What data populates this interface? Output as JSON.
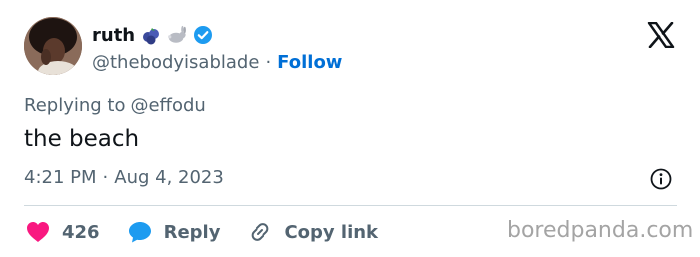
{
  "author": {
    "display_name": "ruth",
    "handle": "@thebodyisablade",
    "separator": "·",
    "follow_label": "Follow",
    "badges": [
      "blueberries-emoji",
      "rabbit-emoji",
      "verified-badge-icon"
    ]
  },
  "platform_icon": "x-logo-icon",
  "tweet": {
    "reply_prefix": "Replying to",
    "reply_handle": "@effodu",
    "text": "the beach",
    "time": "4:21 PM",
    "separator": "·",
    "date": "Aug 4, 2023"
  },
  "actions": {
    "like_count": "426",
    "reply_label": "Reply",
    "copy_label": "Copy link"
  },
  "watermark": "boredpanda.com",
  "colors": {
    "like": "#f91880",
    "link": "#006fd6",
    "verified": "#1d9bf0",
    "muted": "#536471",
    "text": "#0f1419"
  }
}
